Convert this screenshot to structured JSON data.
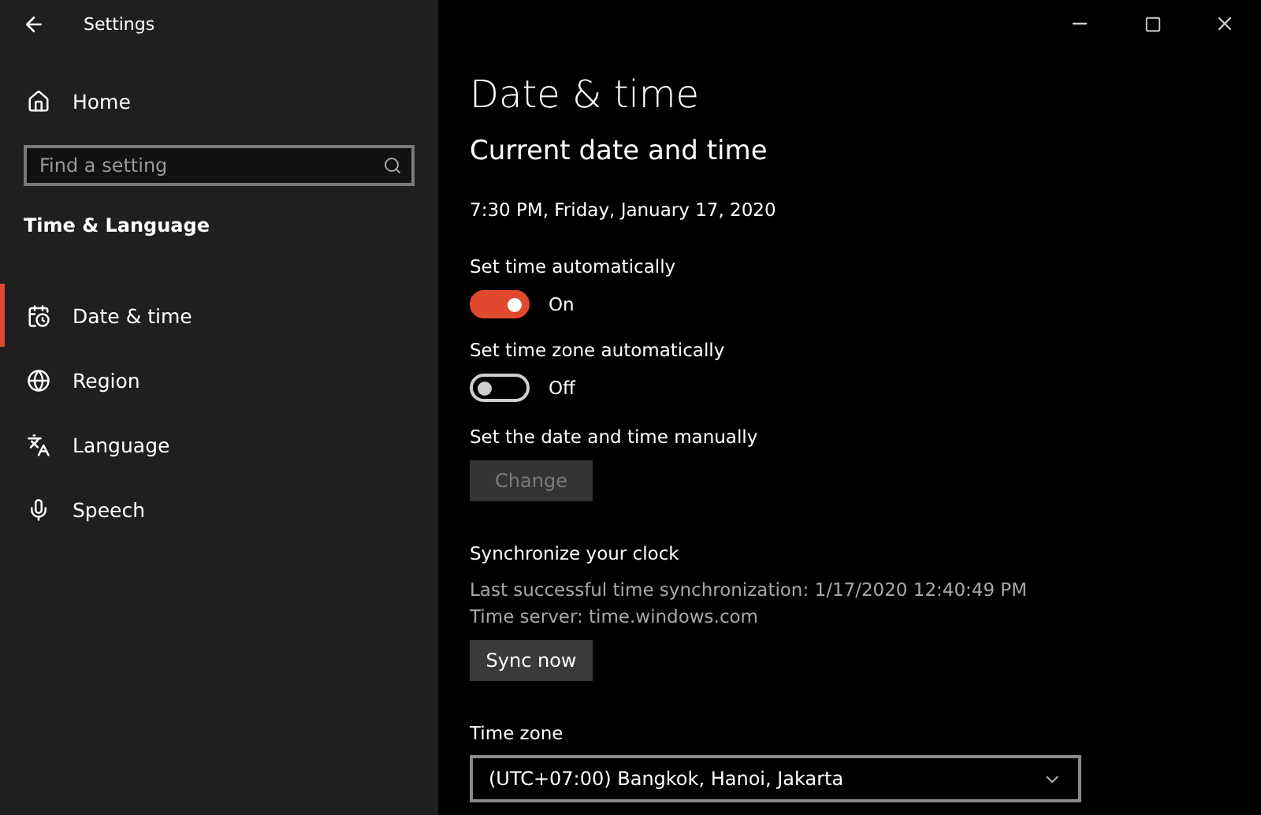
{
  "window": {
    "title": "Settings"
  },
  "sidebar": {
    "home": "Home",
    "search": {
      "placeholder": "Find a setting"
    },
    "heading": "Time & Language",
    "items": [
      {
        "label": "Date & time",
        "selected": true
      },
      {
        "label": "Region",
        "selected": false
      },
      {
        "label": "Language",
        "selected": false
      },
      {
        "label": "Speech",
        "selected": false
      }
    ]
  },
  "page": {
    "title": "Date & time",
    "section": "Current date and time",
    "current": "7:30 PM, Friday, January 17, 2020",
    "toggles": [
      {
        "label": "Set time automatically",
        "on": true,
        "state": "On"
      },
      {
        "label": "Set time zone automatically",
        "on": false,
        "state": "Off"
      }
    ],
    "manual": {
      "label": "Set the date and time manually",
      "button": "Change",
      "disabled": true
    },
    "sync": {
      "heading": "Synchronize your clock",
      "lines": [
        "Last successful time synchronization: 1/17/2020 12:40:49 PM",
        "Time server: time.windows.com"
      ],
      "button": "Sync now",
      "disabled": false
    },
    "timezone": {
      "label": "Time zone",
      "value": "(UTC+07:00) Bangkok, Hanoi, Jakarta"
    }
  }
}
